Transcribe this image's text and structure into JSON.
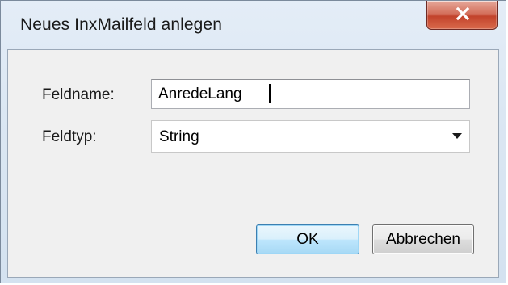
{
  "window": {
    "title": "Neues InxMailfeld anlegen"
  },
  "form": {
    "field_name_label": "Feldname:",
    "field_name_value": "AnredeLang",
    "field_type_label": "Feldtyp:",
    "field_type_value": "String"
  },
  "buttons": {
    "ok_label": "OK",
    "cancel_label": "Abbrechen"
  },
  "icons": {
    "close": "close-icon",
    "dropdown": "chevron-down-icon"
  },
  "colors": {
    "close_button": "#c2432b",
    "default_button": "#bee6fd",
    "window_frame": "#dbe7f3"
  }
}
